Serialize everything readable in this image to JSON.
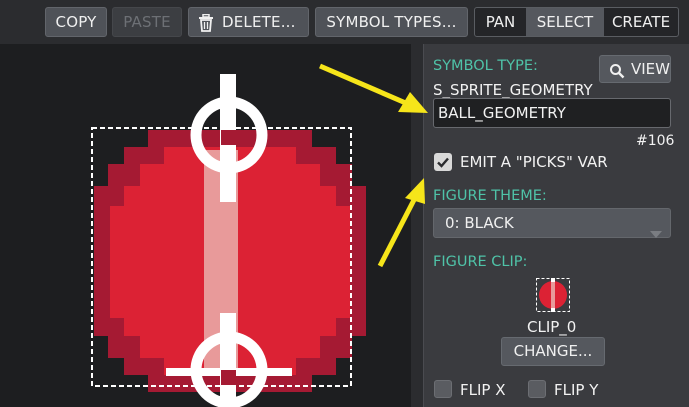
{
  "toolbar": {
    "copy": "COPY",
    "paste": "PASTE",
    "delete": "DELETE...",
    "symbol_types": "SYMBOL TYPES...",
    "modes": [
      "PAN",
      "SELECT",
      "CREATE"
    ],
    "active_mode": "SELECT"
  },
  "panel": {
    "symbol_type_label": "SYMBOL TYPE:",
    "view_label": "VIEW",
    "symbol_type_value": "S_SPRITE_GEOMETRY",
    "name_value": "BALL_GEOMETRY",
    "id": "#106",
    "emit_picks_label": "EMIT A \"PICKS\" VAR",
    "emit_picks_checked": true,
    "figure_theme_label": "FIGURE THEME:",
    "figure_theme_value": "0: BLACK",
    "figure_clip_label": "FIGURE CLIP:",
    "clip_name": "CLIP_0",
    "change_label": "CHANGE...",
    "flip_x_label": "FLIP X",
    "flip_y_label": "FLIP Y",
    "flip_x_checked": false,
    "flip_y_checked": false
  },
  "colors": {
    "ball_red": "#dc2234",
    "ball_dark": "#a51a33",
    "highlight": "#e89a9a",
    "accent_teal": "#4fc3a8",
    "arrow_yellow": "#f6e51a"
  }
}
